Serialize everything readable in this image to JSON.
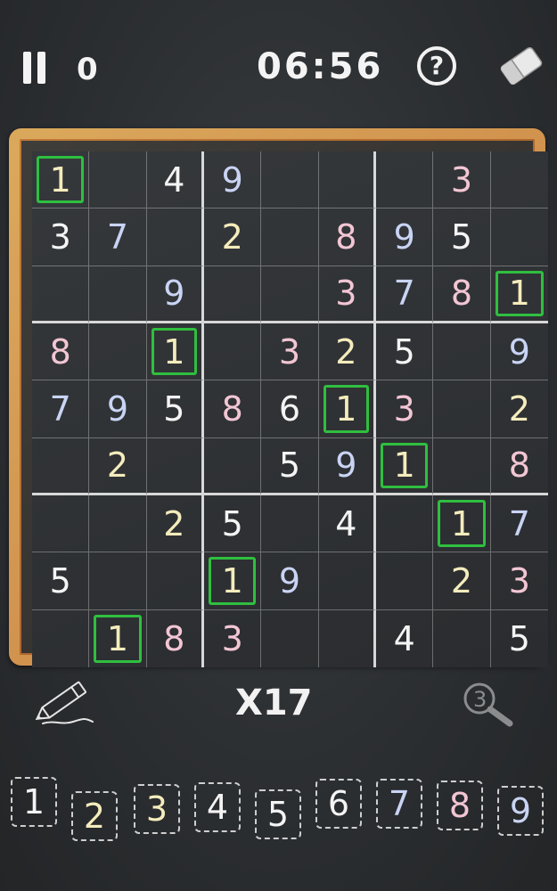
{
  "header": {
    "mistakes": "0",
    "timer": "06:56"
  },
  "icons": {
    "pause": "pause-icon",
    "help": "help-icon",
    "eraser": "eraser-icon",
    "pencil": "pencil-icon",
    "magnifier": "hint-magnifier-icon"
  },
  "colors": {
    "highlight": "#2fbf3f",
    "white": "#f4f4f4",
    "pink": "#f3c6d4",
    "blue": "#c9d4f4",
    "yellow": "#f4ecbc",
    "frame": "#c88c52"
  },
  "board": {
    "rows": [
      [
        {
          "v": "1",
          "c": "yellow",
          "h": true
        },
        {
          "v": "",
          "c": ""
        },
        {
          "v": "4",
          "c": "white"
        },
        {
          "v": "9",
          "c": "blue"
        },
        {
          "v": "",
          "c": ""
        },
        {
          "v": "",
          "c": ""
        },
        {
          "v": "",
          "c": ""
        },
        {
          "v": "3",
          "c": "pink"
        },
        {
          "v": "",
          "c": ""
        }
      ],
      [
        {
          "v": "3",
          "c": "white"
        },
        {
          "v": "7",
          "c": "blue"
        },
        {
          "v": "",
          "c": ""
        },
        {
          "v": "2",
          "c": "yellow"
        },
        {
          "v": "",
          "c": ""
        },
        {
          "v": "8",
          "c": "pink"
        },
        {
          "v": "9",
          "c": "blue"
        },
        {
          "v": "5",
          "c": "white"
        },
        {
          "v": "",
          "c": ""
        }
      ],
      [
        {
          "v": "",
          "c": ""
        },
        {
          "v": "",
          "c": ""
        },
        {
          "v": "9",
          "c": "blue"
        },
        {
          "v": "",
          "c": ""
        },
        {
          "v": "",
          "c": ""
        },
        {
          "v": "3",
          "c": "pink"
        },
        {
          "v": "7",
          "c": "blue"
        },
        {
          "v": "8",
          "c": "pink"
        },
        {
          "v": "1",
          "c": "yellow",
          "h": true
        }
      ],
      [
        {
          "v": "8",
          "c": "pink"
        },
        {
          "v": "",
          "c": ""
        },
        {
          "v": "1",
          "c": "yellow",
          "h": true
        },
        {
          "v": "",
          "c": ""
        },
        {
          "v": "3",
          "c": "pink"
        },
        {
          "v": "2",
          "c": "yellow"
        },
        {
          "v": "5",
          "c": "white"
        },
        {
          "v": "",
          "c": ""
        },
        {
          "v": "9",
          "c": "blue"
        }
      ],
      [
        {
          "v": "7",
          "c": "blue"
        },
        {
          "v": "9",
          "c": "blue"
        },
        {
          "v": "5",
          "c": "white"
        },
        {
          "v": "8",
          "c": "pink"
        },
        {
          "v": "6",
          "c": "white"
        },
        {
          "v": "1",
          "c": "yellow",
          "h": true
        },
        {
          "v": "3",
          "c": "pink"
        },
        {
          "v": "",
          "c": ""
        },
        {
          "v": "2",
          "c": "yellow"
        }
      ],
      [
        {
          "v": "",
          "c": ""
        },
        {
          "v": "2",
          "c": "yellow"
        },
        {
          "v": "",
          "c": ""
        },
        {
          "v": "",
          "c": ""
        },
        {
          "v": "5",
          "c": "white"
        },
        {
          "v": "9",
          "c": "blue"
        },
        {
          "v": "1",
          "c": "yellow",
          "h": true
        },
        {
          "v": "",
          "c": ""
        },
        {
          "v": "8",
          "c": "pink"
        }
      ],
      [
        {
          "v": "",
          "c": ""
        },
        {
          "v": "",
          "c": ""
        },
        {
          "v": "2",
          "c": "yellow"
        },
        {
          "v": "5",
          "c": "white"
        },
        {
          "v": "",
          "c": ""
        },
        {
          "v": "4",
          "c": "white"
        },
        {
          "v": "",
          "c": ""
        },
        {
          "v": "1",
          "c": "yellow",
          "h": true
        },
        {
          "v": "7",
          "c": "blue"
        }
      ],
      [
        {
          "v": "5",
          "c": "white"
        },
        {
          "v": "",
          "c": ""
        },
        {
          "v": "",
          "c": ""
        },
        {
          "v": "1",
          "c": "yellow",
          "h": true
        },
        {
          "v": "9",
          "c": "blue"
        },
        {
          "v": "",
          "c": ""
        },
        {
          "v": "",
          "c": ""
        },
        {
          "v": "2",
          "c": "yellow"
        },
        {
          "v": "3",
          "c": "pink"
        }
      ],
      [
        {
          "v": "",
          "c": ""
        },
        {
          "v": "1",
          "c": "yellow",
          "h": true
        },
        {
          "v": "8",
          "c": "pink"
        },
        {
          "v": "3",
          "c": "pink"
        },
        {
          "v": "",
          "c": ""
        },
        {
          "v": "",
          "c": ""
        },
        {
          "v": "4",
          "c": "white"
        },
        {
          "v": "",
          "c": ""
        },
        {
          "v": "5",
          "c": "white"
        }
      ]
    ]
  },
  "hint_count": "X17",
  "number_pad": [
    {
      "label": "1",
      "c": "white"
    },
    {
      "label": "2",
      "c": "yellow"
    },
    {
      "label": "3",
      "c": "yellow"
    },
    {
      "label": "4",
      "c": "white"
    },
    {
      "label": "5",
      "c": "white"
    },
    {
      "label": "6",
      "c": "white"
    },
    {
      "label": "7",
      "c": "blue"
    },
    {
      "label": "8",
      "c": "pink"
    },
    {
      "label": "9",
      "c": "blue"
    }
  ]
}
